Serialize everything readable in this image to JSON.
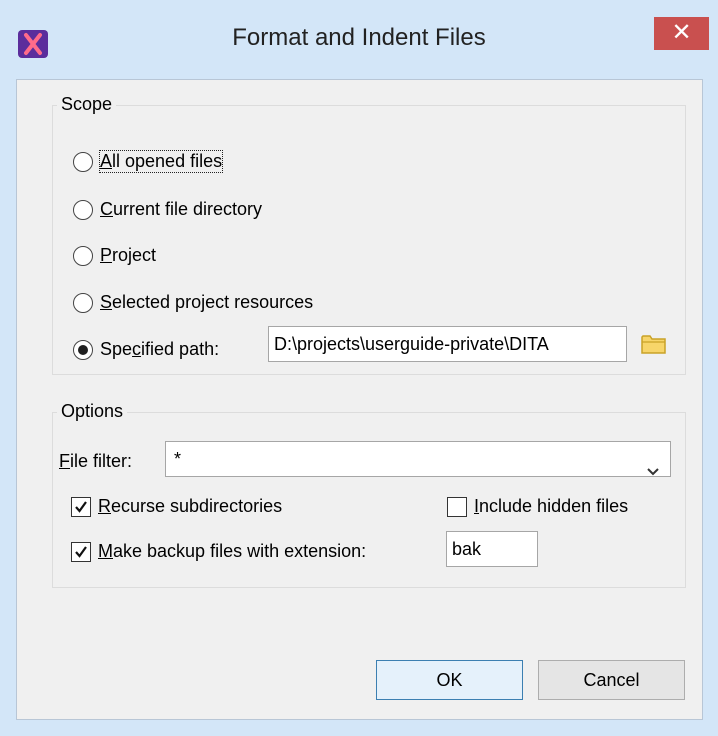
{
  "window": {
    "title": "Format and Indent Files",
    "close_symbol": "✕"
  },
  "scope": {
    "legend": "Scope",
    "options": [
      {
        "label": "All opened files",
        "mnemonic": "A",
        "rest": "ll opened files",
        "checked": false
      },
      {
        "label": "Current file directory",
        "mnemonic": "C",
        "rest": "urrent file directory",
        "checked": false
      },
      {
        "label": "Project",
        "mnemonic": "P",
        "rest": "roject",
        "checked": false
      },
      {
        "label": "Selected project resources",
        "mnemonic": "S",
        "rest": "elected project resources",
        "checked": false
      },
      {
        "label": "Specified path:",
        "pre": "Spe",
        "mnemonic": "c",
        "rest": "ified path:",
        "checked": true
      }
    ],
    "path_value": "D:\\projects\\userguide-private\\DITA",
    "folder_icon": "folder-icon"
  },
  "options": {
    "legend": "Options",
    "file_filter_label_mn": "F",
    "file_filter_label_rest": "ile filter:",
    "file_filter_value": "*",
    "recurse_mn": "R",
    "recurse_rest": "ecurse subdirectories",
    "recurse_checked": true,
    "hidden_mn": "I",
    "hidden_rest": "nclude hidden files",
    "hidden_checked": false,
    "backup_mn": "M",
    "backup_rest": "ake backup files with extension:",
    "backup_checked": true,
    "backup_ext": "bak"
  },
  "buttons": {
    "ok": "OK",
    "cancel": "Cancel"
  },
  "colors": {
    "title_bg": "#d3e6f8",
    "close_bg": "#c9504f",
    "client_bg": "#f0f0f0",
    "default_btn_border": "#3c7fb1"
  }
}
